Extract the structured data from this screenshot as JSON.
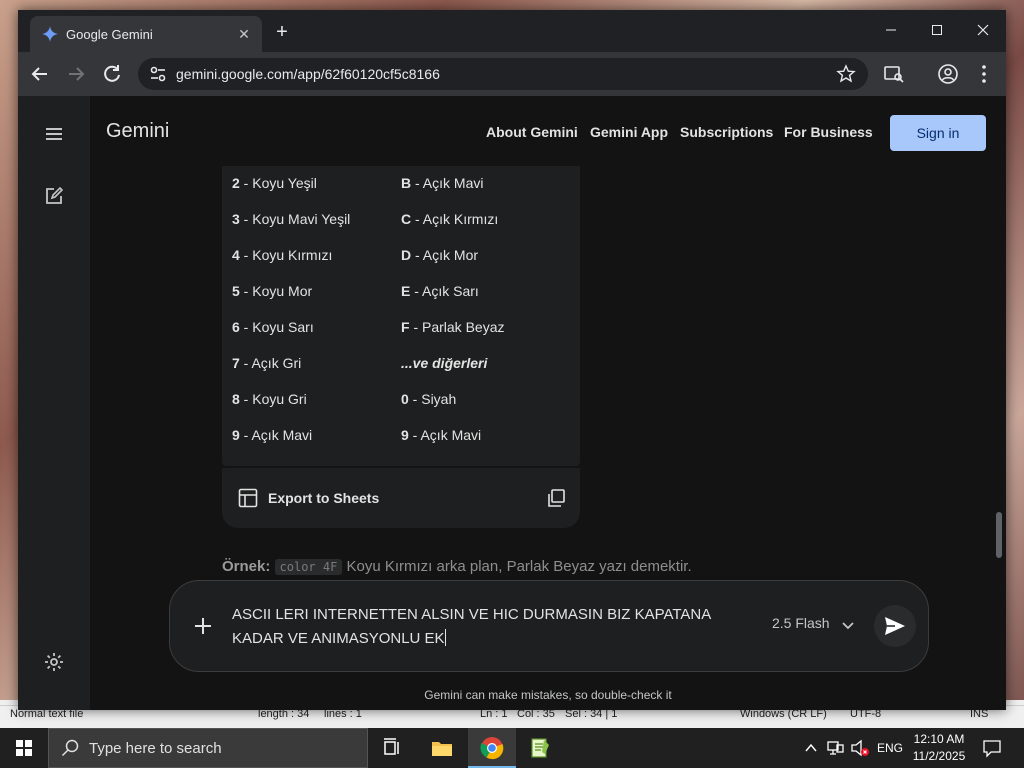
{
  "desktop": {
    "status_bar": {
      "file_type": "Normal text file",
      "length": "length : 34",
      "lines": "lines : 1",
      "ln": "Ln : 1",
      "col": "Col : 35",
      "sel": "Sel : 34 | 1",
      "eol": "Windows (CR LF)",
      "encoding": "UTF-8",
      "mode": "INS"
    }
  },
  "browser": {
    "tab_title": "Google Gemini",
    "url": "gemini.google.com/app/62f60120cf5c8166"
  },
  "gemini": {
    "brand": "Gemini",
    "nav": {
      "about": "About Gemini",
      "app": "Gemini App",
      "subscriptions": "Subscriptions",
      "business": "For Business",
      "sign_in": "Sign in"
    },
    "color_table": [
      {
        "left_code": "2",
        "left_name": "Koyu Yeşil",
        "right_code": "B",
        "right_name": "Açık Mavi"
      },
      {
        "left_code": "3",
        "left_name": "Koyu Mavi Yeşil",
        "right_code": "C",
        "right_name": "Açık Kırmızı"
      },
      {
        "left_code": "4",
        "left_name": "Koyu Kırmızı",
        "right_code": "D",
        "right_name": "Açık Mor"
      },
      {
        "left_code": "5",
        "left_name": "Koyu Mor",
        "right_code": "E",
        "right_name": "Açık Sarı"
      },
      {
        "left_code": "6",
        "left_name": "Koyu Sarı",
        "right_code": "F",
        "right_name": "Parlak Beyaz"
      },
      {
        "left_code": "7",
        "left_name": "Açık Gri",
        "right_code": "",
        "right_name": "...ve diğerleri"
      },
      {
        "left_code": "8",
        "left_name": "Koyu Gri",
        "right_code": "0",
        "right_name": "Siyah"
      },
      {
        "left_code": "9",
        "left_name": "Açık Mavi",
        "right_code": "9",
        "right_name": "Açık Mavi"
      }
    ],
    "separator": " - ",
    "export_label": "Export to Sheets",
    "example": {
      "label": "Örnek:",
      "code": "color 4F",
      "text": "Koyu Kırmızı arka plan, Parlak Beyaz yazı demektir."
    },
    "prompt_text": "ASCII LERI INTERNETTEN ALSIN VE HIC DURMASIN BIZ KAPATANA KADAR VE ANIMASYONLU EK",
    "model": "2.5 Flash",
    "disclaimer": "Gemini can make mistakes, so double-check it"
  },
  "taskbar": {
    "search_placeholder": "Type here to search",
    "language": "ENG",
    "time": "12:10 AM",
    "date": "11/2/2025"
  },
  "colors": {
    "accent": "#a8c7fa",
    "page_bg": "#131314",
    "surface": "#1e1f20"
  }
}
